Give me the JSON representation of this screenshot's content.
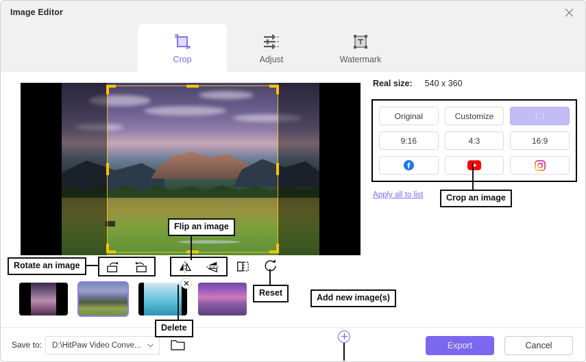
{
  "window": {
    "title": "Image Editor",
    "close_icon": "close-icon"
  },
  "tabs": [
    {
      "label": "Crop",
      "icon": "crop-icon",
      "active": true
    },
    {
      "label": "Adjust",
      "icon": "sliders-icon",
      "active": false
    },
    {
      "label": "Watermark",
      "icon": "watermark-text-icon",
      "active": false
    }
  ],
  "preview": {
    "crop_overlay": "crop-selection-handles"
  },
  "right_panel": {
    "real_size_label": "Real size:",
    "real_size_value": "540 x 360",
    "ratios": [
      {
        "label": "Original",
        "selected": false
      },
      {
        "label": "Customize",
        "selected": false
      },
      {
        "label": "1:1",
        "selected": true
      },
      {
        "label": "9:16",
        "selected": false
      },
      {
        "label": "4:3",
        "selected": false
      },
      {
        "label": "16:9",
        "selected": false
      }
    ],
    "social": [
      {
        "name": "facebook-icon",
        "color": "#1877F2"
      },
      {
        "name": "youtube-icon",
        "color": "#FF0000"
      },
      {
        "name": "instagram-icon",
        "color": "#E1306C"
      }
    ],
    "apply_all_link": "Apply all to list"
  },
  "callouts": {
    "crop_an_image": "Crop an image",
    "flip_an_image": "Flip an image",
    "rotate_an_image": "Rotate an image",
    "reset": "Reset",
    "delete": "Delete",
    "add_new_images": "Add new image(s)"
  },
  "tools": [
    {
      "name": "rotate-right-icon",
      "group": "rotate"
    },
    {
      "name": "rotate-left-icon",
      "group": "rotate"
    },
    {
      "name": "flip-horizontal-icon",
      "group": "flip"
    },
    {
      "name": "flip-vertical-icon",
      "group": "flip"
    },
    {
      "name": "mirror-icon",
      "group": "plain"
    },
    {
      "name": "reset-icon",
      "group": "plain"
    }
  ],
  "thumbnails": [
    {
      "name": "thumbnail-1",
      "selected": false,
      "has_delete": false
    },
    {
      "name": "thumbnail-2",
      "selected": true,
      "has_delete": false
    },
    {
      "name": "thumbnail-3",
      "selected": false,
      "has_delete": true
    },
    {
      "name": "thumbnail-4",
      "selected": false,
      "has_delete": false
    }
  ],
  "add_button": {
    "icon": "plus-circle-icon"
  },
  "footer": {
    "save_to_label": "Save to:",
    "save_path": "D:\\HitPaw Video Conve...",
    "dropdown_icon": "chevron-down-icon",
    "folder_icon": "folder-icon",
    "export_label": "Export",
    "cancel_label": "Cancel"
  },
  "colors": {
    "accent": "#7b68ee",
    "accent_selected_bg": "#c3bcf5",
    "crop_handle": "#ffc400",
    "titlebar_bg": "#f1f1f1"
  }
}
